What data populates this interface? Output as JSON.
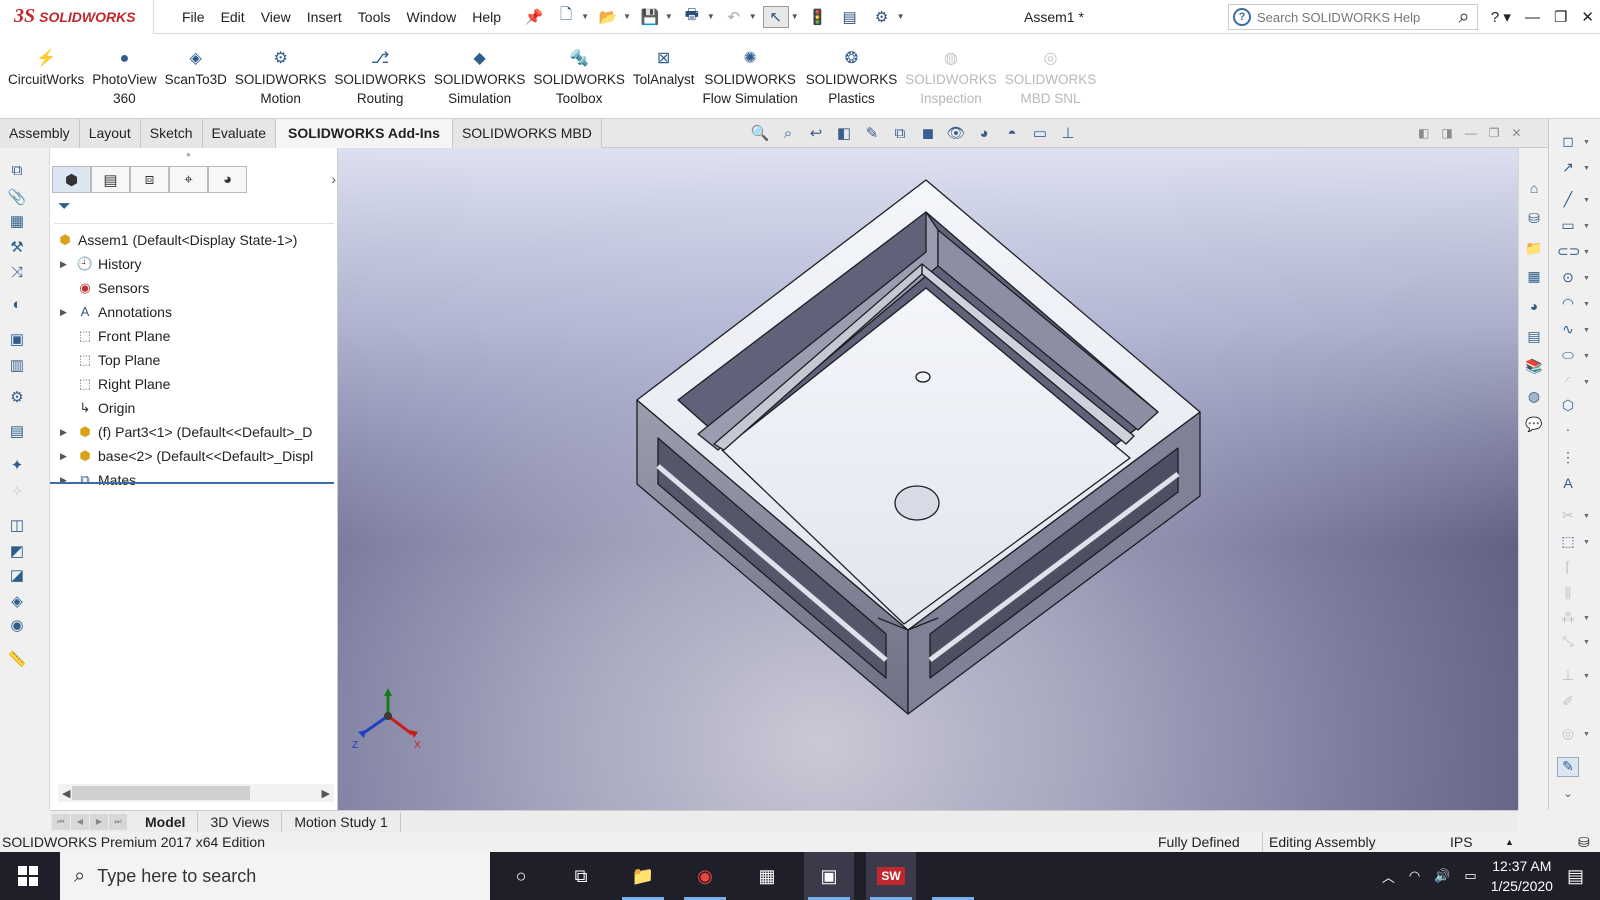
{
  "titlebar": {
    "logo_ds": "3S",
    "logo_text": "SOLIDWORKS",
    "menus": [
      "File",
      "Edit",
      "View",
      "Insert",
      "Tools",
      "Window",
      "Help"
    ],
    "doc_title": "Assem1 *",
    "search_placeholder": "Search SOLIDWORKS Help"
  },
  "ribbon": [
    {
      "l1": "CircuitWorks",
      "l2": "",
      "enabled": true,
      "icon": "circuitworks-icon"
    },
    {
      "l1": "PhotoView",
      "l2": "360",
      "enabled": true,
      "icon": "photoview-icon"
    },
    {
      "l1": "ScanTo3D",
      "l2": "",
      "enabled": true,
      "icon": "scanto3d-icon"
    },
    {
      "l1": "SOLIDWORKS",
      "l2": "Motion",
      "enabled": true,
      "icon": "motion-icon"
    },
    {
      "l1": "SOLIDWORKS",
      "l2": "Routing",
      "enabled": true,
      "icon": "routing-icon"
    },
    {
      "l1": "SOLIDWORKS",
      "l2": "Simulation",
      "enabled": true,
      "icon": "simulation-icon"
    },
    {
      "l1": "SOLIDWORKS",
      "l2": "Toolbox",
      "enabled": true,
      "icon": "toolbox-icon"
    },
    {
      "l1": "TolAnalyst",
      "l2": "",
      "enabled": true,
      "icon": "tolanalyst-icon"
    },
    {
      "l1": "SOLIDWORKS",
      "l2": "Flow Simulation",
      "enabled": true,
      "icon": "flow-simulation-icon"
    },
    {
      "l1": "SOLIDWORKS",
      "l2": "Plastics",
      "enabled": true,
      "icon": "plastics-icon"
    },
    {
      "l1": "SOLIDWORKS",
      "l2": "Inspection",
      "enabled": false,
      "icon": "inspection-icon"
    },
    {
      "l1": "SOLIDWORKS",
      "l2": "MBD SNL",
      "enabled": false,
      "icon": "mbd-snl-icon"
    }
  ],
  "command_tabs": [
    "Assembly",
    "Layout",
    "Sketch",
    "Evaluate",
    "SOLIDWORKS Add-Ins",
    "SOLIDWORKS MBD"
  ],
  "active_command_tab": "SOLIDWORKS Add-Ins",
  "tree": [
    {
      "label": "Assem1  (Default<Display State-1>)",
      "icon": "assembly-icon",
      "level": 0,
      "expander": false
    },
    {
      "label": "History",
      "icon": "history-icon",
      "level": 1,
      "expander": true
    },
    {
      "label": "Sensors",
      "icon": "sensors-icon",
      "level": 1,
      "expander": false
    },
    {
      "label": "Annotations",
      "icon": "annotations-icon",
      "level": 1,
      "expander": true
    },
    {
      "label": "Front Plane",
      "icon": "plane-icon",
      "level": 1,
      "expander": false
    },
    {
      "label": "Top Plane",
      "icon": "plane-icon",
      "level": 1,
      "expander": false
    },
    {
      "label": "Right Plane",
      "icon": "plane-icon",
      "level": 1,
      "expander": false
    },
    {
      "label": "Origin",
      "icon": "origin-icon",
      "level": 1,
      "expander": false
    },
    {
      "label": "(f) Part3<1> (Default<<Default>_D",
      "icon": "part-icon",
      "level": 1,
      "expander": true
    },
    {
      "label": "base<2> (Default<<Default>_Displ",
      "icon": "part-icon",
      "level": 1,
      "expander": true
    },
    {
      "label": "Mates",
      "icon": "mates-icon",
      "level": 1,
      "expander": true
    }
  ],
  "bottom_tabs": [
    "Model",
    "3D Views",
    "Motion Study 1"
  ],
  "active_bottom_tab": "Model",
  "status": {
    "edition": "SOLIDWORKS Premium 2017 x64 Edition",
    "defined": "Fully Defined",
    "mode": "Editing Assembly",
    "units": "IPS"
  },
  "triad": {
    "x": "X",
    "y": "Y",
    "z": "Z"
  },
  "taskbar": {
    "search_placeholder": "Type here to search",
    "time": "12:37 AM",
    "date": "1/25/2020"
  },
  "colors": {
    "brand": "#c1272d",
    "accent": "#3a6ea5",
    "taskbar": "#1f1f2a"
  }
}
